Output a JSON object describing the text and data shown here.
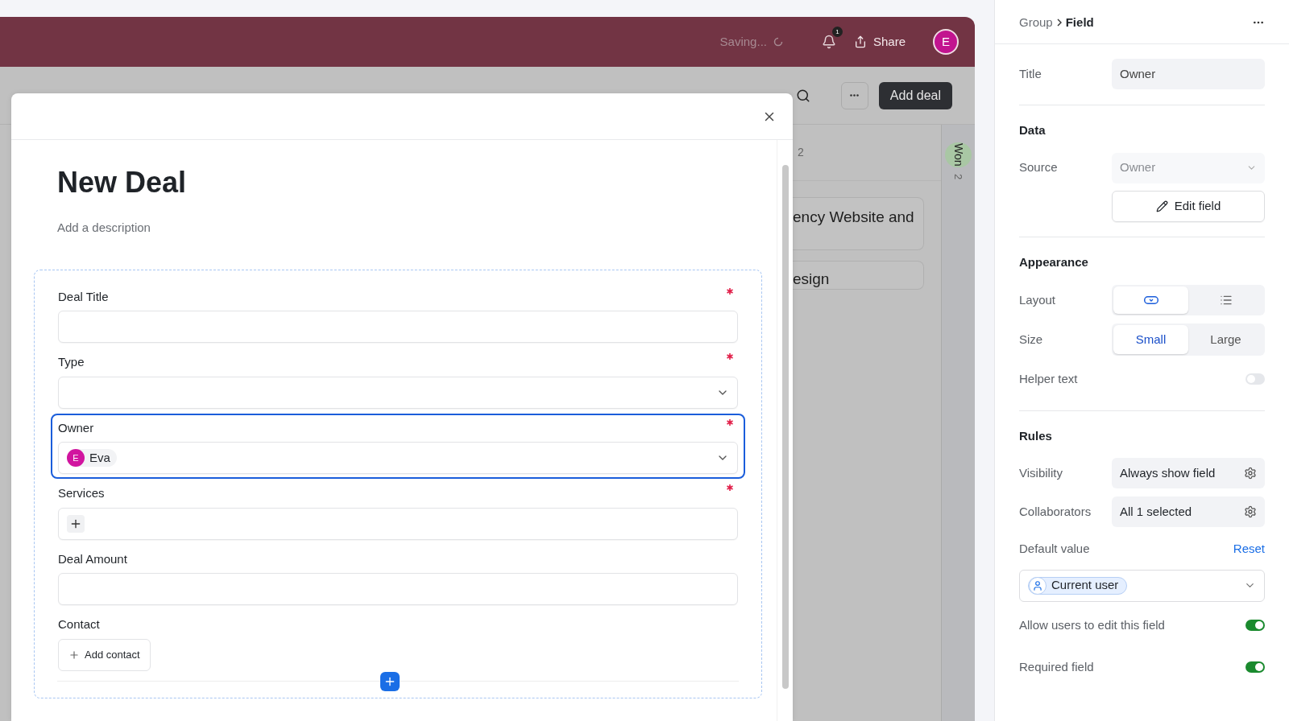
{
  "top_bar": {
    "status": "Saving...",
    "notification_count": "1",
    "share": "Share",
    "avatar": "E"
  },
  "toolbar": {
    "add_button": "Add deal"
  },
  "board": {
    "column_count": "2",
    "cards": [
      "ency Website and",
      "esign"
    ],
    "won": {
      "label": "Won",
      "count": "2"
    }
  },
  "modal": {
    "title": "New Deal",
    "description_placeholder": "Add a description",
    "fields": [
      {
        "kind": "text",
        "label": "Deal Title",
        "required": true,
        "selected": false
      },
      {
        "kind": "select",
        "label": "Type",
        "required": true,
        "selected": false
      },
      {
        "kind": "select",
        "label": "Owner",
        "required": true,
        "selected": true,
        "value": {
          "avatar": "E",
          "name": "Eva"
        }
      },
      {
        "kind": "multi",
        "label": "Services",
        "required": true,
        "selected": false
      },
      {
        "kind": "text",
        "label": "Deal Amount",
        "required": false,
        "selected": false
      },
      {
        "kind": "button",
        "label": "Contact",
        "required": false,
        "selected": false,
        "button": "Add contact"
      }
    ]
  },
  "panel": {
    "breadcrumb": {
      "parent": "Group",
      "current": "Field"
    },
    "title": {
      "label": "Title",
      "value": "Owner"
    },
    "data": {
      "heading": "Data",
      "source_label": "Source",
      "source_value": "Owner",
      "edit_button": "Edit field"
    },
    "appearance": {
      "heading": "Appearance",
      "layout_label": "Layout",
      "layout_options": [
        {
          "kind": "dropdown",
          "selected": true
        },
        {
          "kind": "list",
          "selected": false
        }
      ],
      "size_label": "Size",
      "size_options": [
        {
          "label": "Small",
          "selected": true
        },
        {
          "label": "Large",
          "selected": false
        }
      ],
      "helper_label": "Helper text",
      "helper_on": false
    },
    "rules": {
      "heading": "Rules",
      "visibility_label": "Visibility",
      "visibility_value": "Always show field",
      "collaborators_label": "Collaborators",
      "collaborators_value": "All 1 selected",
      "default_label": "Default value",
      "reset": "Reset",
      "default_value": "Current user",
      "toggles": [
        {
          "label": "Allow users to edit this field",
          "on": true
        },
        {
          "label": "Required field",
          "on": true
        }
      ]
    }
  }
}
